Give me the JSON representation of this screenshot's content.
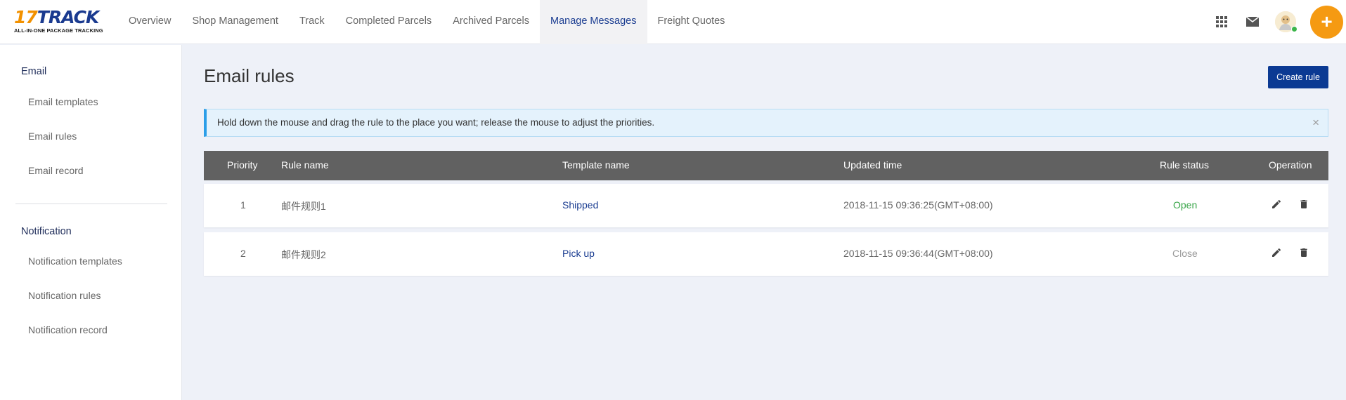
{
  "logo": {
    "main_a": "17",
    "main_b": "TRACK",
    "sub": "ALL-IN-ONE PACKAGE TRACKING"
  },
  "nav": {
    "items": [
      {
        "label": "Overview"
      },
      {
        "label": "Shop Management"
      },
      {
        "label": "Track"
      },
      {
        "label": "Completed Parcels"
      },
      {
        "label": "Archived Parcels"
      },
      {
        "label": "Manage Messages",
        "active": true
      },
      {
        "label": "Freight Quotes"
      }
    ]
  },
  "top_icons": [
    "apps-grid-icon",
    "mail-icon",
    "avatar",
    "plus-icon"
  ],
  "plus_label": "+",
  "sidebar": {
    "email_group": "Email",
    "email_items": [
      {
        "label": "Email templates"
      },
      {
        "label": "Email rules"
      },
      {
        "label": "Email record"
      }
    ],
    "notification_group": "Notification",
    "notification_items": [
      {
        "label": "Notification templates"
      },
      {
        "label": "Notification rules"
      },
      {
        "label": "Notification record"
      }
    ]
  },
  "main": {
    "title": "Email rules",
    "create_button": "Create rule",
    "alert": {
      "text": "Hold down the mouse and drag the rule to the place you want; release the mouse to adjust the priorities.",
      "close": "×"
    }
  },
  "table": {
    "headers": {
      "priority": "Priority",
      "rule_name": "Rule name",
      "template_name": "Template name",
      "updated_time": "Updated time",
      "rule_status": "Rule status",
      "operation": "Operation"
    },
    "rows": [
      {
        "priority": "1",
        "rule_name": "邮件规则1",
        "template_name": "Shipped",
        "updated_time": "2018-11-15 09:36:25(GMT+08:00)",
        "status": "Open"
      },
      {
        "priority": "2",
        "rule_name": "邮件规则2",
        "template_name": "Pick up",
        "updated_time": "2018-11-15 09:36:44(GMT+08:00)",
        "status": "Close"
      }
    ],
    "operation_icons": [
      "edit-icon",
      "delete-icon"
    ]
  },
  "colors": {
    "brand_blue": "#1b3d91",
    "brand_orange": "#f59a12",
    "status_open": "#3aa64a",
    "status_close": "#999999",
    "table_header": "#616161",
    "alert_accent": "#2b9ee8"
  }
}
